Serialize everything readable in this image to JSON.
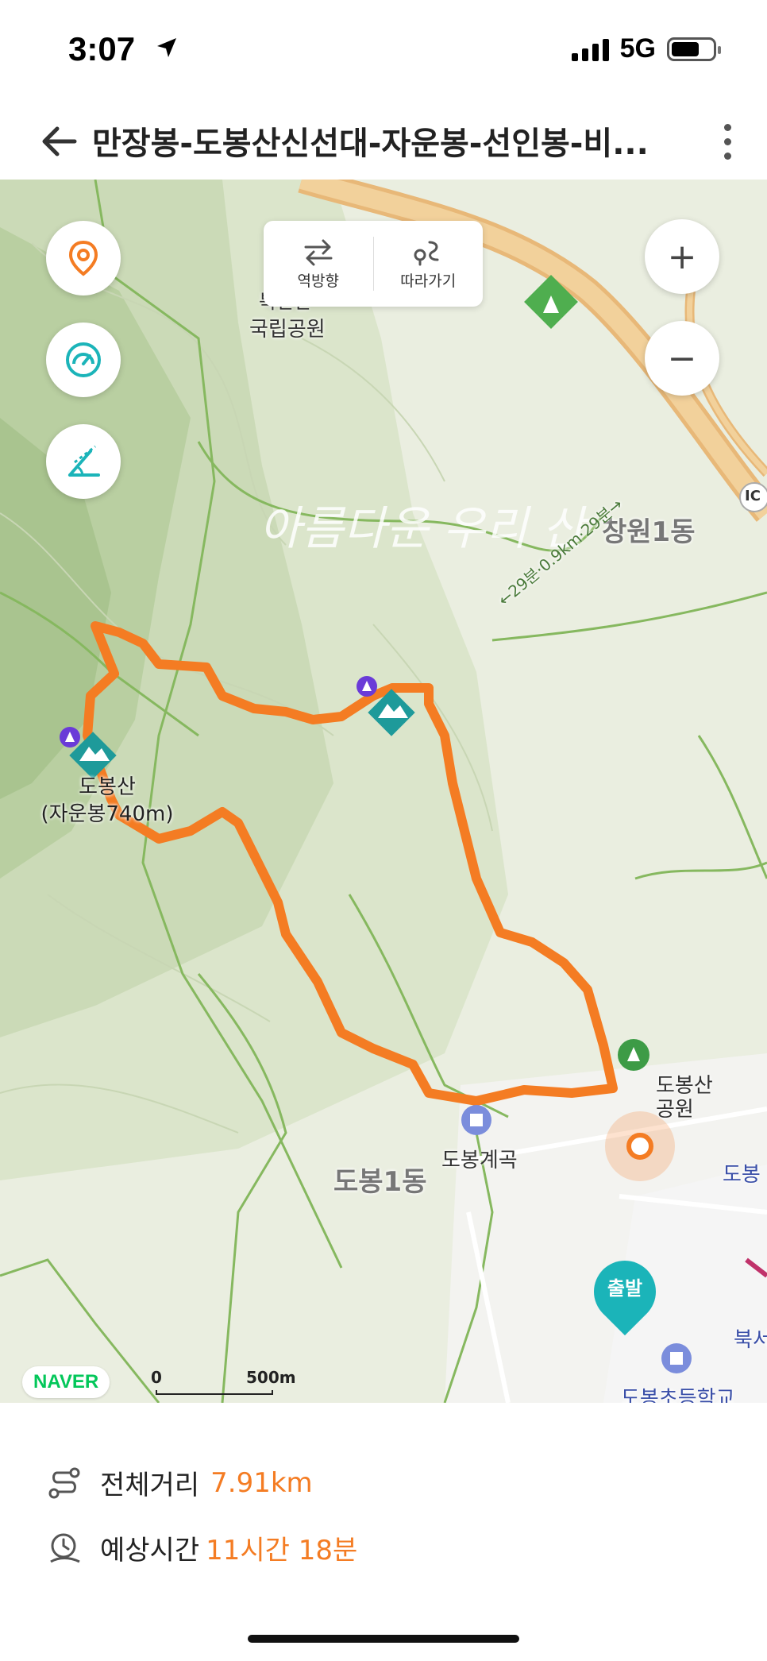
{
  "status_bar": {
    "time": "3:07",
    "network": "5G"
  },
  "header": {
    "title": "만장봉-도봉산신선대-자운봉-선인봉-비..."
  },
  "map_controls": {
    "reverse_label": "역방향",
    "follow_label": "따라가기",
    "zoom_in": "+",
    "zoom_out": "−"
  },
  "map_labels": {
    "park_name": "국립공원",
    "park_name_top": "북한산",
    "district_1": "도봉1동",
    "district_2": "창원1동",
    "summit_name": "도봉산",
    "summit_sub": "(자운봉740m)",
    "valley": "도봉계곡",
    "station": "도봉산",
    "station_sub": "공원",
    "route_hint": "←29분·0.9km·29분→",
    "interchange": "IC",
    "east_label": "도봉",
    "north_label": "북서",
    "school": "도봉초등학교",
    "watermark": "아름다운 우리 산",
    "start_pin": "출발"
  },
  "map_footer": {
    "brand": "NAVER",
    "scale_zero": "0",
    "scale_max": "500m"
  },
  "route_info": {
    "distance_label": "전체거리",
    "distance_value": "7.91km",
    "time_label": "예상시간",
    "time_value": "11시간 18분"
  },
  "colors": {
    "route": "#f47c23",
    "accent": "#1bb4b9",
    "brand": "#03c75a"
  }
}
